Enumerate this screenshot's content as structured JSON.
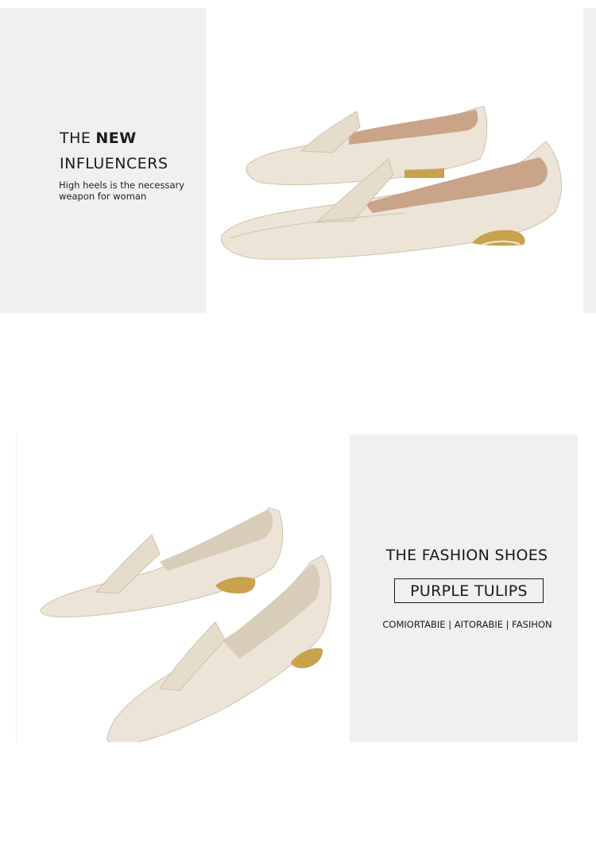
{
  "hero": {
    "line1_regular": "THE",
    "line1_bold": "NEW",
    "line2": "INFLUENCERS",
    "tagline": "High heels is the necessary weapon for woman"
  },
  "feature": {
    "title": "THE FASHION SHOES",
    "boxed_label": "PURPLE TULIPS",
    "features": "COMIORTABIE | AITORABIE | FASIHON"
  },
  "product_images": [
    {
      "icon": "loafer-pair-side-view-icon"
    },
    {
      "icon": "loafer-pair-angled-view-icon"
    }
  ],
  "colors": {
    "panel_gray": "#f0f0f0",
    "leather_cream": "#ece4d6",
    "leather_shadow": "#d4c8b4",
    "lining_tan": "#c9a489",
    "heel_gold": "#c8a24c"
  }
}
